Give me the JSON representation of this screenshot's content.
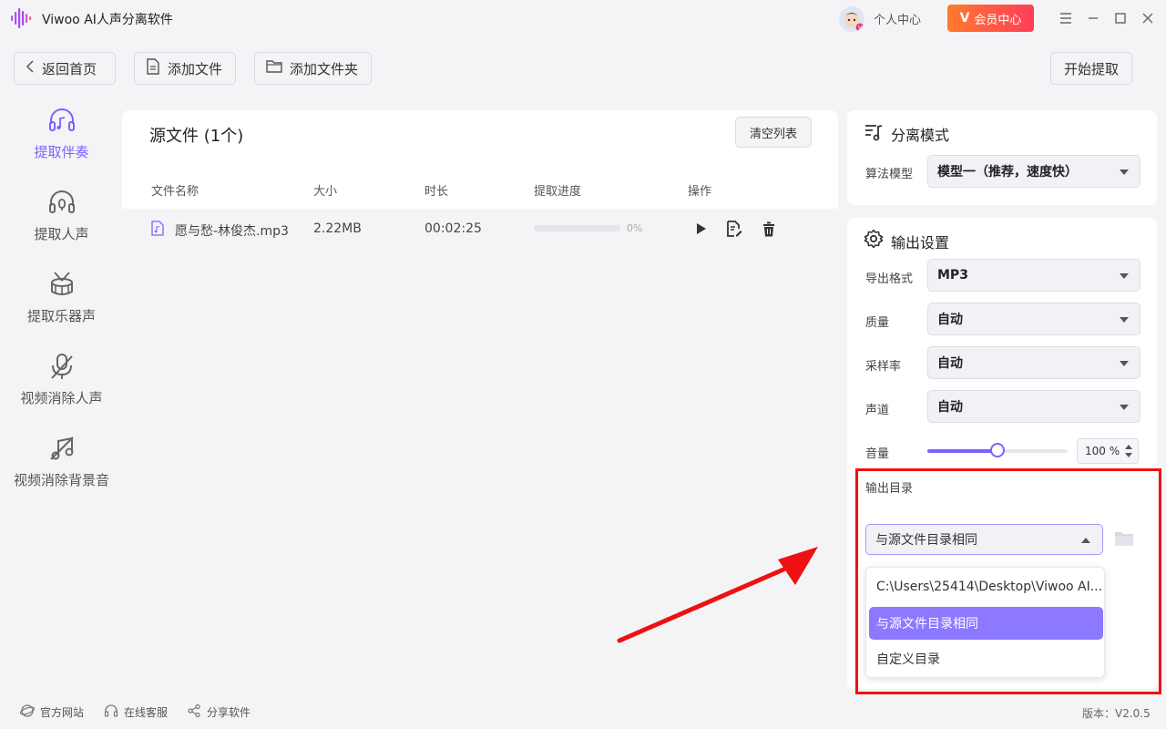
{
  "app": {
    "title": "Viwoo AI人声分离软件"
  },
  "header": {
    "user_center": "个人中心",
    "vip_label": "会员中心",
    "vip_badge": "V"
  },
  "toolbar": {
    "back": "返回首页",
    "add_file": "添加文件",
    "add_folder": "添加文件夹",
    "start": "开始提取"
  },
  "sidebar": {
    "items": [
      {
        "label": "提取伴奏",
        "icon": "headphones-music-icon",
        "active": true
      },
      {
        "label": "提取人声",
        "icon": "headphones-mic-icon",
        "active": false
      },
      {
        "label": "提取乐器声",
        "icon": "drum-icon",
        "active": false
      },
      {
        "label": "视频消除人声",
        "icon": "mic-off-icon",
        "active": false
      },
      {
        "label": "视频消除背景音",
        "icon": "music-off-icon",
        "active": false
      }
    ]
  },
  "file_list": {
    "title": "源文件 (1个)",
    "clear_label": "清空列表",
    "columns": [
      "文件名称",
      "大小",
      "时长",
      "提取进度",
      "操作"
    ],
    "rows": [
      {
        "name": "愿与愁-林俊杰.mp3",
        "size": "2.22MB",
        "duration": "00:02:25",
        "progress": 0,
        "progress_label": "0%"
      }
    ]
  },
  "separation": {
    "title": "分离模式",
    "model_label": "算法模型",
    "model_value": "模型一（推荐，速度快）"
  },
  "output": {
    "title": "输出设置",
    "format_label": "导出格式",
    "format_value": "MP3",
    "quality_label": "质量",
    "quality_value": "自动",
    "samplerate_label": "采样率",
    "samplerate_value": "自动",
    "channel_label": "声道",
    "channel_value": "自动",
    "volume_label": "音量",
    "volume_value": 100,
    "volume_display": "100 %",
    "dir_label": "输出目录",
    "dir_value": "与源文件目录相同",
    "dir_options": [
      "C:\\Users\\25414\\Desktop\\Viwoo AI...",
      "与源文件目录相同",
      "自定义目录"
    ]
  },
  "footer": {
    "website": "官方网站",
    "support": "在线客服",
    "share": "分享软件",
    "version": "版本：V2.0.5"
  },
  "colors": {
    "accent": "#7b61ff",
    "highlight": "#ee1111",
    "arrow": "#ee1111",
    "vip_start": "#ff7a2e",
    "vip_end": "#ff3d5a"
  }
}
